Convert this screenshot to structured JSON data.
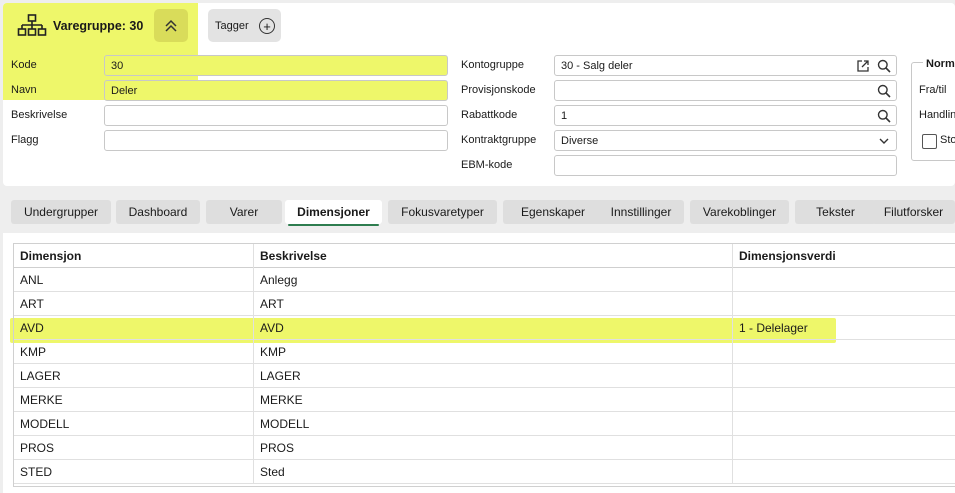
{
  "header": {
    "title": "Varegruppe: 30",
    "tag_label": "Tagger"
  },
  "form_left": {
    "kode_label": "Kode",
    "kode_value": "30",
    "navn_label": "Navn",
    "navn_value": "Deler",
    "beskrivelse_label": "Beskrivelse",
    "beskrivelse_value": "",
    "flagg_label": "Flagg",
    "flagg_value": ""
  },
  "form_mid": {
    "kontogruppe_label": "Kontogruppe",
    "kontogruppe_value": "30 - Salg deler",
    "provisjonskode_label": "Provisjonskode",
    "provisjonskode_value": "",
    "rabattkode_label": "Rabattkode",
    "rabattkode_value": "1",
    "kontraktgruppe_label": "Kontraktgruppe",
    "kontraktgruppe_value": "Diverse",
    "ebm_label": "EBM-kode",
    "ebm_value": ""
  },
  "form_right": {
    "legend": "Norm",
    "fratil_label": "Fra/til",
    "handling_label": "Handlin",
    "checkbox_label": "Sto"
  },
  "tabs": [
    {
      "label": "Undergrupper"
    },
    {
      "label": "Dashboard"
    },
    {
      "label": "Varer"
    },
    {
      "label": "Dimensjoner"
    },
    {
      "label": "Fokusvaretyper"
    },
    {
      "label": "Egenskaper"
    },
    {
      "label": "Innstillinger"
    },
    {
      "label": "Varekoblinger"
    },
    {
      "label": "Tekster"
    },
    {
      "label": "Filutforsker"
    }
  ],
  "table": {
    "columns": [
      "Dimensjon",
      "Beskrivelse",
      "Dimensjonsverdi"
    ],
    "rows": [
      [
        "ANL",
        "Anlegg",
        ""
      ],
      [
        "ART",
        "ART",
        ""
      ],
      [
        "AVD",
        "AVD",
        "1 - Delelager"
      ],
      [
        "KMP",
        "KMP",
        ""
      ],
      [
        "LAGER",
        "LAGER",
        ""
      ],
      [
        "MERKE",
        "MERKE",
        ""
      ],
      [
        "MODELL",
        "MODELL",
        ""
      ],
      [
        "PROS",
        "PROS",
        ""
      ],
      [
        "STED",
        "Sted",
        ""
      ]
    ]
  },
  "colors": {
    "highlight": "#eef76a",
    "active_tab_underline": "#2e7d4f"
  },
  "icons": {
    "title": "hierarchy-icon",
    "collapse": "chevron-double-up-icon",
    "tag_add": "plus-circle-icon",
    "search": "search-icon",
    "open_external": "external-link-icon",
    "dropdown": "chevron-down-icon"
  }
}
